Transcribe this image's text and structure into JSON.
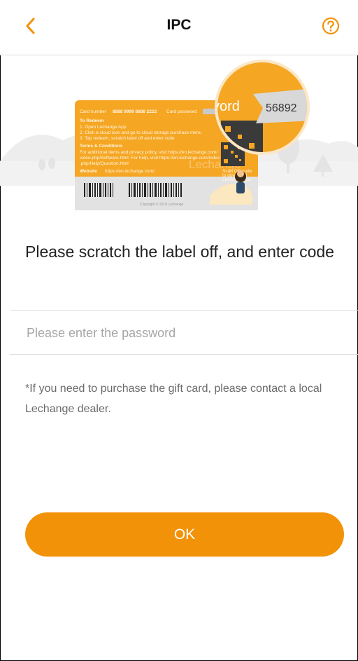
{
  "header": {
    "title": "IPC",
    "back_icon": "chevron-left-icon",
    "help_icon": "question-circle-icon"
  },
  "illustration": {
    "card_number_label": "Card number",
    "card_number": "8888 9999 8888 2222",
    "card_password_label": "Card password",
    "to_redeem_label": "To Redeem",
    "redeem_steps": [
      "1. Open Lechange App",
      "2. Click a cloud icon and go to cloud storage purchase menu",
      "3. Tap redeem, scratch label off and enter code"
    ],
    "terms_label": "Terms & Conditions",
    "terms_text": [
      "For additional items and privacy policy, visit https://en.lechange.com/",
      "video.php/Software.html. For help, visit https://en.lechange.com/index",
      ".php/Help/Question.html"
    ],
    "website_label": "Website",
    "website": "https://en.lechange.com/",
    "qr_caption": [
      "Scan QR code",
      "to download",
      "Lechange App"
    ],
    "copyright": "Copyright © 2018 Lechange",
    "watermark": "Lechange",
    "zoom_word": "vord",
    "zoom_code": "56892"
  },
  "main": {
    "instruction": "Please scratch the label off, and enter code",
    "password_placeholder": "Please enter the password",
    "password_value": "",
    "note": "*If you need to purchase the gift card, please contact a local Lechange dealer.",
    "ok_label": "OK"
  },
  "colors": {
    "accent": "#f29208",
    "card_orange": "#f5a623",
    "background": "#ffffff"
  }
}
